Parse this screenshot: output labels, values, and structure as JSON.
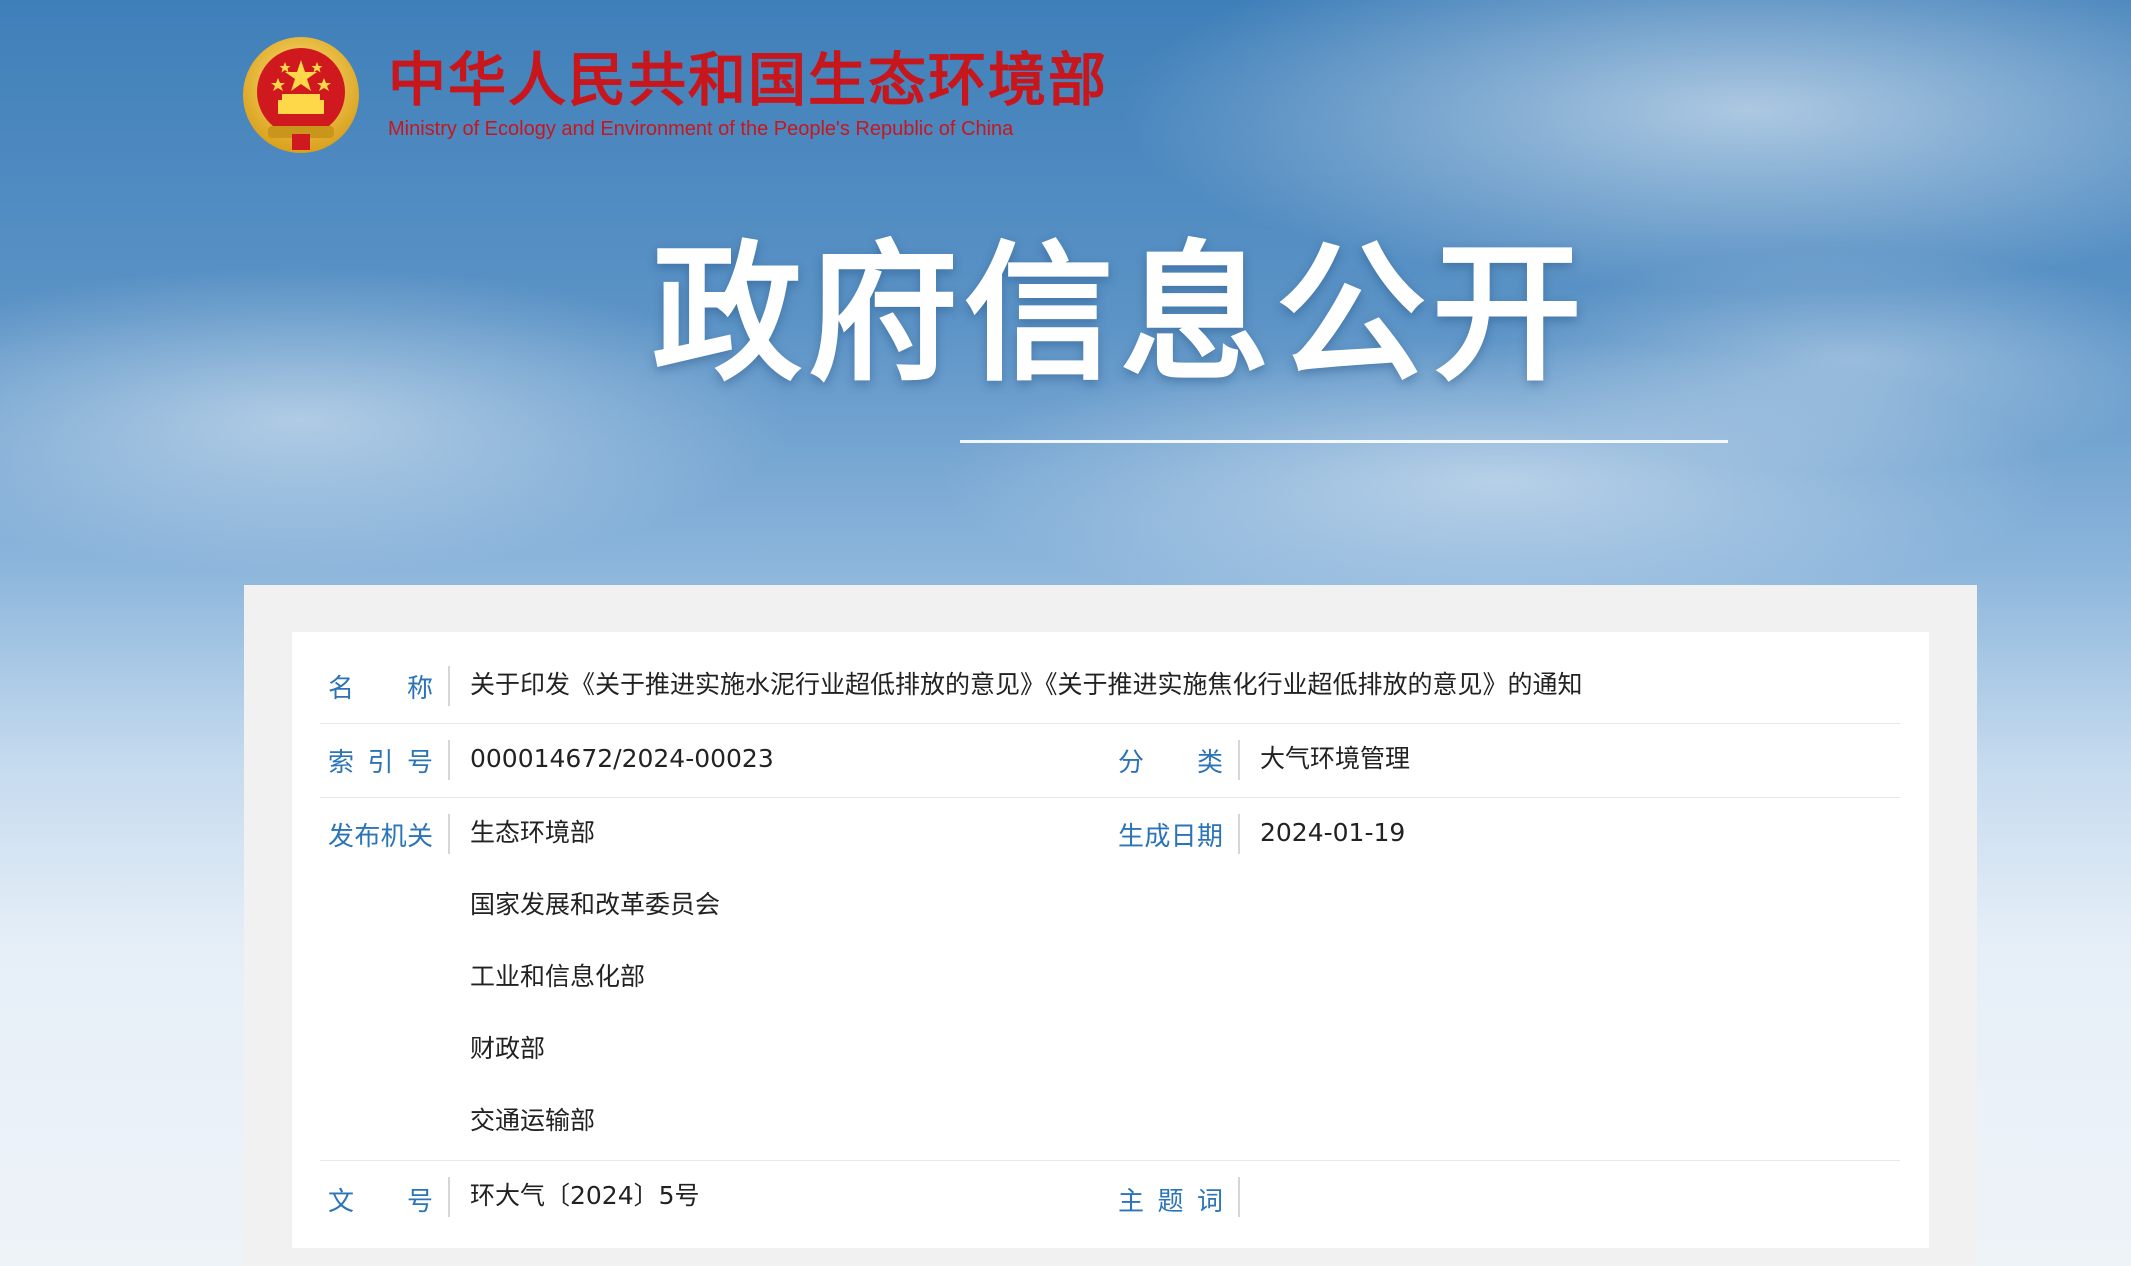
{
  "site": {
    "name_cn": "中华人民共和国生态环境部",
    "name_en": "Ministry of Ecology and Environment of the People's Republic of China",
    "emblem_icon": "national-emblem-icon"
  },
  "page": {
    "title": "政府信息公开"
  },
  "colors": {
    "brand_red": "#c8161d",
    "label_blue": "#2b74b8",
    "text": "#222222"
  },
  "info": {
    "name_label": "名称",
    "name_value": "关于印发《关于推进实施水泥行业超低排放的意见》《关于推进实施焦化行业超低排放的意见》的通知",
    "index_label": "索引号",
    "index_value": "000014672/2024-00023",
    "category_label": "分类",
    "category_value": "大气环境管理",
    "publisher_label": "发布机关",
    "publishers": [
      "生态环境部",
      "国家发展和改革委员会",
      "工业和信息化部",
      "财政部",
      "交通运输部"
    ],
    "date_label": "生成日期",
    "date_value": "2024-01-19",
    "doc_no_label": "文号",
    "doc_no_value": "环大气〔2024〕5号",
    "keywords_label": "主题词",
    "keywords_value": ""
  }
}
